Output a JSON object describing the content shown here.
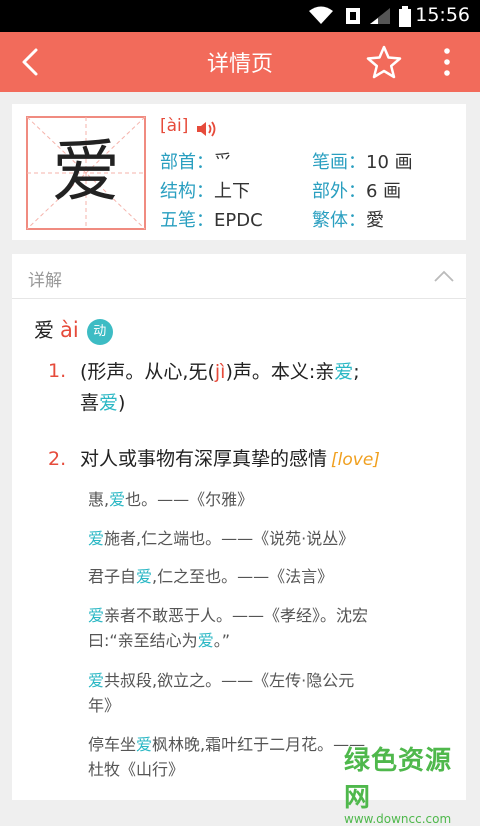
{
  "status_bar": {
    "time": "15:56"
  },
  "app_bar": {
    "title": "详情页"
  },
  "character": {
    "glyph": "爱",
    "pinyin": "[ài]",
    "radical_label": "部首：",
    "radical": "爫",
    "strokes_label": "笔画：",
    "strokes": "10 画",
    "structure_label": "结构：",
    "structure": "上下",
    "outer_label": "部外：",
    "outer": "6 画",
    "wubi_label": "五笔：",
    "wubi": "EPDC",
    "traditional_label": "繁体：",
    "traditional": "愛"
  },
  "detail": {
    "section_title": "详解",
    "entry_char": "爱",
    "entry_pinyin": "ài",
    "pos": "动",
    "definitions": [
      {
        "num": "1.",
        "text_a": "(形声。从心,旡(",
        "text_red": "jì",
        "text_b": ")声。本义:亲",
        "text_hl": "爱",
        "text_c": ";",
        "text_line2a": "喜",
        "text_line2hl": "爱",
        "text_line2b": ")"
      },
      {
        "num": "2.",
        "text": "对人或事物有深厚真挚的感情",
        "english": "[love]"
      }
    ],
    "examples": [
      {
        "pre": "惠,",
        "hl": "爱",
        "post": "也。——《尔雅》"
      },
      {
        "pre": "",
        "hl": "爱",
        "post": "施者,仁之端也。——《说苑·说丛》"
      },
      {
        "pre": "君子自",
        "hl": "爱",
        "post": ",仁之至也。——《法言》"
      },
      {
        "pre": "",
        "hl": "爱",
        "post": "亲者不敢恶于人。——《孝经》。沈宏",
        "line2a": "曰:“亲至结心为",
        "line2hl": "爱",
        "line2b": "。”"
      },
      {
        "pre": "",
        "hl": "爱",
        "post": "共叔段,欲立之。——《左传·隐公元",
        "line2a": "年》"
      },
      {
        "pre": "停车坐",
        "hl": "爱",
        "post": "枫林晚,霜叶红于二月花。——",
        "line2a": "杜牧《山行》"
      }
    ]
  },
  "watermark": {
    "main": "绿色资源网",
    "sub": "www.downcc.com"
  }
}
